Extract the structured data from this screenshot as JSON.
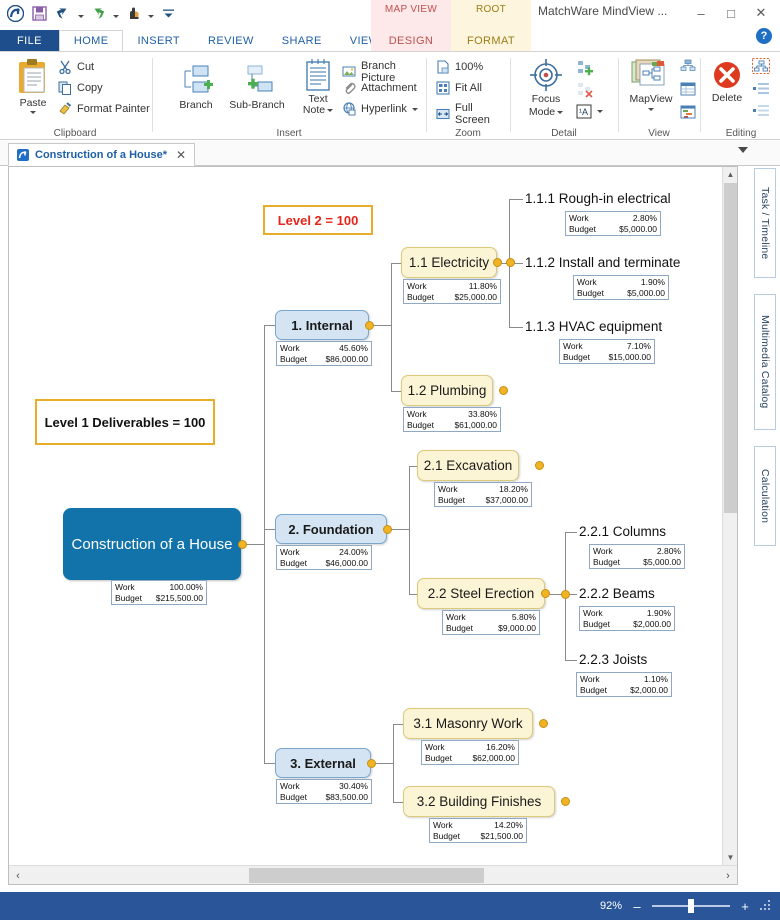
{
  "window": {
    "app_title": "MatchWare MindView ...",
    "minimize": "–",
    "maximize": "□",
    "close": "✕",
    "help": "?"
  },
  "quick_access": {
    "app_icon": "mindview-app-icon",
    "items": [
      "save-icon",
      "undo-icon",
      "redo-icon",
      "hand-tool-icon",
      "customize-qat-icon"
    ]
  },
  "contextual_tabs": [
    {
      "top": "MAP VIEW",
      "bottom": "DESIGN",
      "color": "#c0504d"
    },
    {
      "top": "ROOT",
      "bottom": "FORMAT",
      "color": "#9a7d16"
    }
  ],
  "ribbon_tabs": [
    {
      "label": "FILE",
      "state": "file"
    },
    {
      "label": "HOME",
      "state": "active"
    },
    {
      "label": "INSERT",
      "state": "normal"
    },
    {
      "label": "REVIEW",
      "state": "normal"
    },
    {
      "label": "SHARE",
      "state": "normal"
    },
    {
      "label": "VIEW",
      "state": "normal"
    },
    {
      "label": "DESIGN",
      "state": "ctx-d"
    },
    {
      "label": "FORMAT",
      "state": "ctx-f"
    }
  ],
  "ribbon_groups": {
    "clipboard": {
      "label": "Clipboard",
      "paste": "Paste",
      "cut": "Cut",
      "copy": "Copy",
      "format_painter": "Format Painter"
    },
    "insert": {
      "label": "Insert",
      "branch": "Branch",
      "sub_branch": "Sub-Branch",
      "text_note_1": "Text",
      "text_note_2": "Note",
      "branch_picture": "Branch Picture",
      "attachment": "Attachment",
      "hyperlink": "Hyperlink"
    },
    "zoom": {
      "label": "Zoom",
      "hundred": "100%",
      "fit_all": "Fit All",
      "full_screen": "Full Screen"
    },
    "detail": {
      "label": "Detail",
      "focus_1": "Focus",
      "focus_2": "Mode"
    },
    "view": {
      "label": "View",
      "mapview": "MapView"
    },
    "editing": {
      "label": "Editing",
      "delete": "Delete"
    }
  },
  "document_tab": {
    "title": "Construction of a House*",
    "close": "✕"
  },
  "side_panels": [
    {
      "label": "Task / Timeline"
    },
    {
      "label": "Multimedia Catalog"
    },
    {
      "label": "Calculation"
    }
  ],
  "status_bar": {
    "zoom_level": "92%",
    "zoom_out": "–",
    "zoom_in": "+"
  },
  "data_labels": {
    "work": "Work",
    "budget": "Budget"
  },
  "callouts": [
    {
      "text": "Level 1 Deliverables = 100"
    },
    {
      "text": "Level 2 = 100"
    }
  ],
  "mindmap": {
    "root": {
      "title": "Construction of a House",
      "work": "100.00%",
      "budget": "$215,500.00"
    },
    "level1": [
      {
        "title": "1.  Internal",
        "work": "45.60%",
        "budget": "$86,000.00"
      },
      {
        "title": "2.  Foundation",
        "work": "24.00%",
        "budget": "$46,000.00"
      },
      {
        "title": "3.  External",
        "work": "30.40%",
        "budget": "$83,500.00"
      }
    ],
    "level2": [
      {
        "title": "1.1  Electricity",
        "work": "11.80%",
        "budget": "$25,000.00"
      },
      {
        "title": "1.2  Plumbing",
        "work": "33.80%",
        "budget": "$61,000.00"
      },
      {
        "title": "2.1  Excavation",
        "work": "18.20%",
        "budget": "$37,000.00"
      },
      {
        "title": "2.2  Steel Erection",
        "work": "5.80%",
        "budget": "$9,000.00"
      },
      {
        "title": "3.1  Masonry Work",
        "work": "16.20%",
        "budget": "$62,000.00"
      },
      {
        "title": "3.2  Building Finishes",
        "work": "14.20%",
        "budget": "$21,500.00"
      }
    ],
    "level3": [
      {
        "title": "1.1.1  Rough-in electrical",
        "work": "2.80%",
        "budget": "$5,000.00"
      },
      {
        "title": "1.1.2  Install and terminate",
        "work": "1.90%",
        "budget": "$5,000.00"
      },
      {
        "title": "1.1.3  HVAC equipment",
        "work": "7.10%",
        "budget": "$15,000.00"
      },
      {
        "title": "2.2.1  Columns",
        "work": "2.80%",
        "budget": "$5,000.00"
      },
      {
        "title": "2.2.2  Beams",
        "work": "1.90%",
        "budget": "$2,000.00"
      },
      {
        "title": "2.2.3  Joists",
        "work": "1.10%",
        "budget": "$2,000.00"
      }
    ]
  }
}
